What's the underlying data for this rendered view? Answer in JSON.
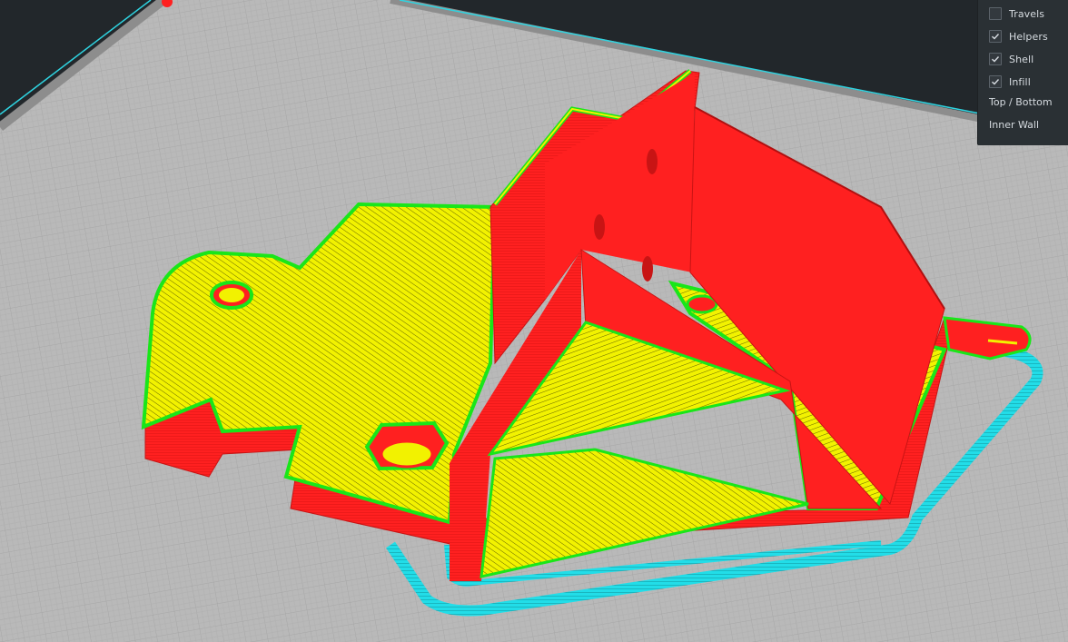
{
  "view_panel": {
    "options": [
      {
        "label": "Travels",
        "checked": false
      },
      {
        "label": "Helpers",
        "checked": true
      },
      {
        "label": "Shell",
        "checked": true
      },
      {
        "label": "Infill",
        "checked": true
      }
    ],
    "entries": [
      {
        "label": "Top / Bottom"
      },
      {
        "label": "Inner Wall"
      }
    ]
  },
  "colors": {
    "background": "#22272b",
    "build_plate": "#b9b9b9",
    "grid_line": "#a2a2a2",
    "plate_edge": "#8d8d8d",
    "shell": "#ff2020",
    "shell_dark": "#c81414",
    "top_bottom": "#f2f200",
    "inner_wall": "#19e619",
    "helpers": "#22dde8",
    "panel_bg": "#2a3034",
    "panel_text": "#d6dbe0"
  }
}
